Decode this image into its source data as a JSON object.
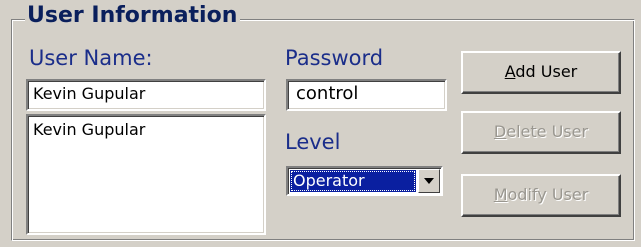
{
  "group": {
    "title": "User Information"
  },
  "user_name": {
    "label": "User Name:",
    "value": "Kevin Gupular"
  },
  "users_list": {
    "items": [
      "Kevin Gupular"
    ]
  },
  "password": {
    "label": "Password",
    "value": "control"
  },
  "level": {
    "label": "Level",
    "selected": "Operator"
  },
  "buttons": {
    "add": {
      "mnemonic": "A",
      "rest": "dd User",
      "enabled": true
    },
    "delete": {
      "mnemonic": "D",
      "rest": "elete User",
      "enabled": false
    },
    "modify": {
      "mnemonic": "M",
      "rest": "odify User",
      "enabled": false
    }
  },
  "icons": {
    "combo_arrow": "chevron-down-icon"
  },
  "colors": {
    "background": "#d4d0c8",
    "label_text": "#1a2d8a",
    "selection": "#0a1fa0",
    "disabled_text": "#9a9790"
  }
}
